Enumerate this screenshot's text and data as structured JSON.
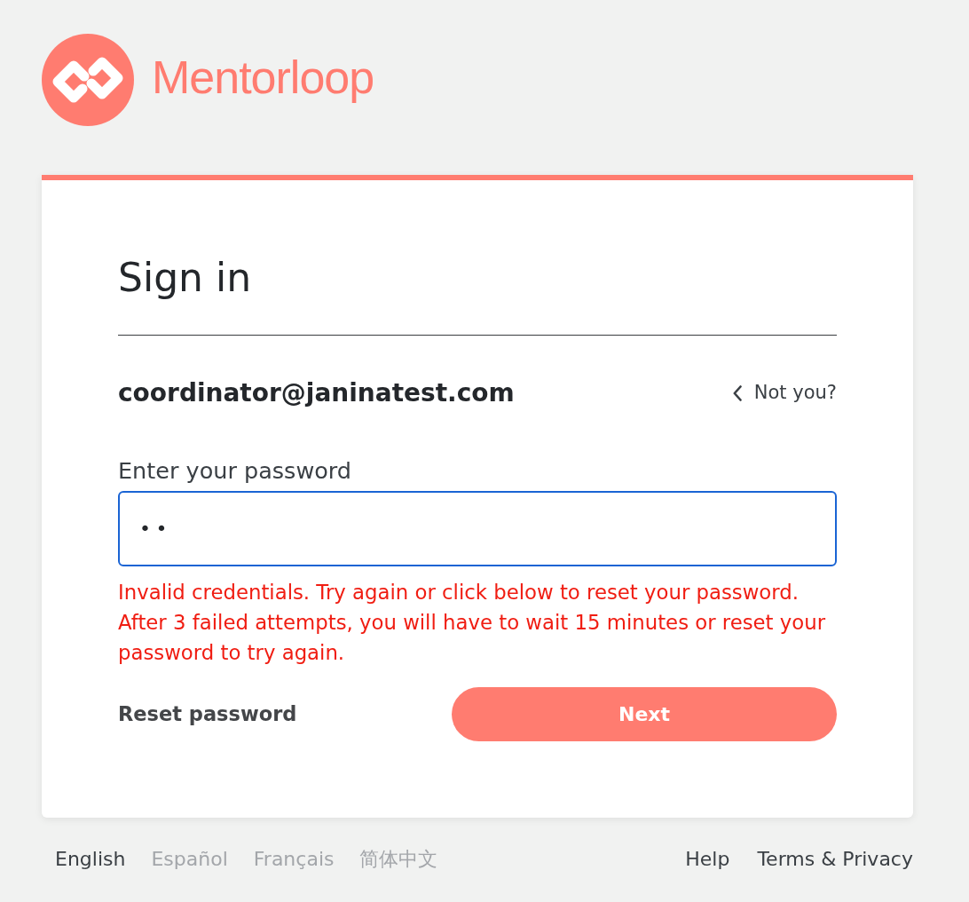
{
  "logo": {
    "text": "Mentorloop"
  },
  "card": {
    "title": "Sign in",
    "account": {
      "email": "coordinator@janinatest.com",
      "switch_link": "Not you?"
    },
    "password_field": {
      "label": "Enter your password",
      "value": "••",
      "focused": true
    },
    "error": "Invalid credentials. Try again or click below to reset your password. After 3 failed attempts, you will have to wait 15 minutes or reset your password to try again.",
    "actions": {
      "reset_link": "Reset password",
      "submit_button": "Next"
    }
  },
  "footer": {
    "languages": [
      {
        "label": "English",
        "selected": true
      },
      {
        "label": "Español",
        "selected": false
      },
      {
        "label": "Français",
        "selected": false
      },
      {
        "label": "简体中文",
        "selected": false
      }
    ],
    "links": [
      "Help",
      "Terms & Privacy"
    ]
  }
}
